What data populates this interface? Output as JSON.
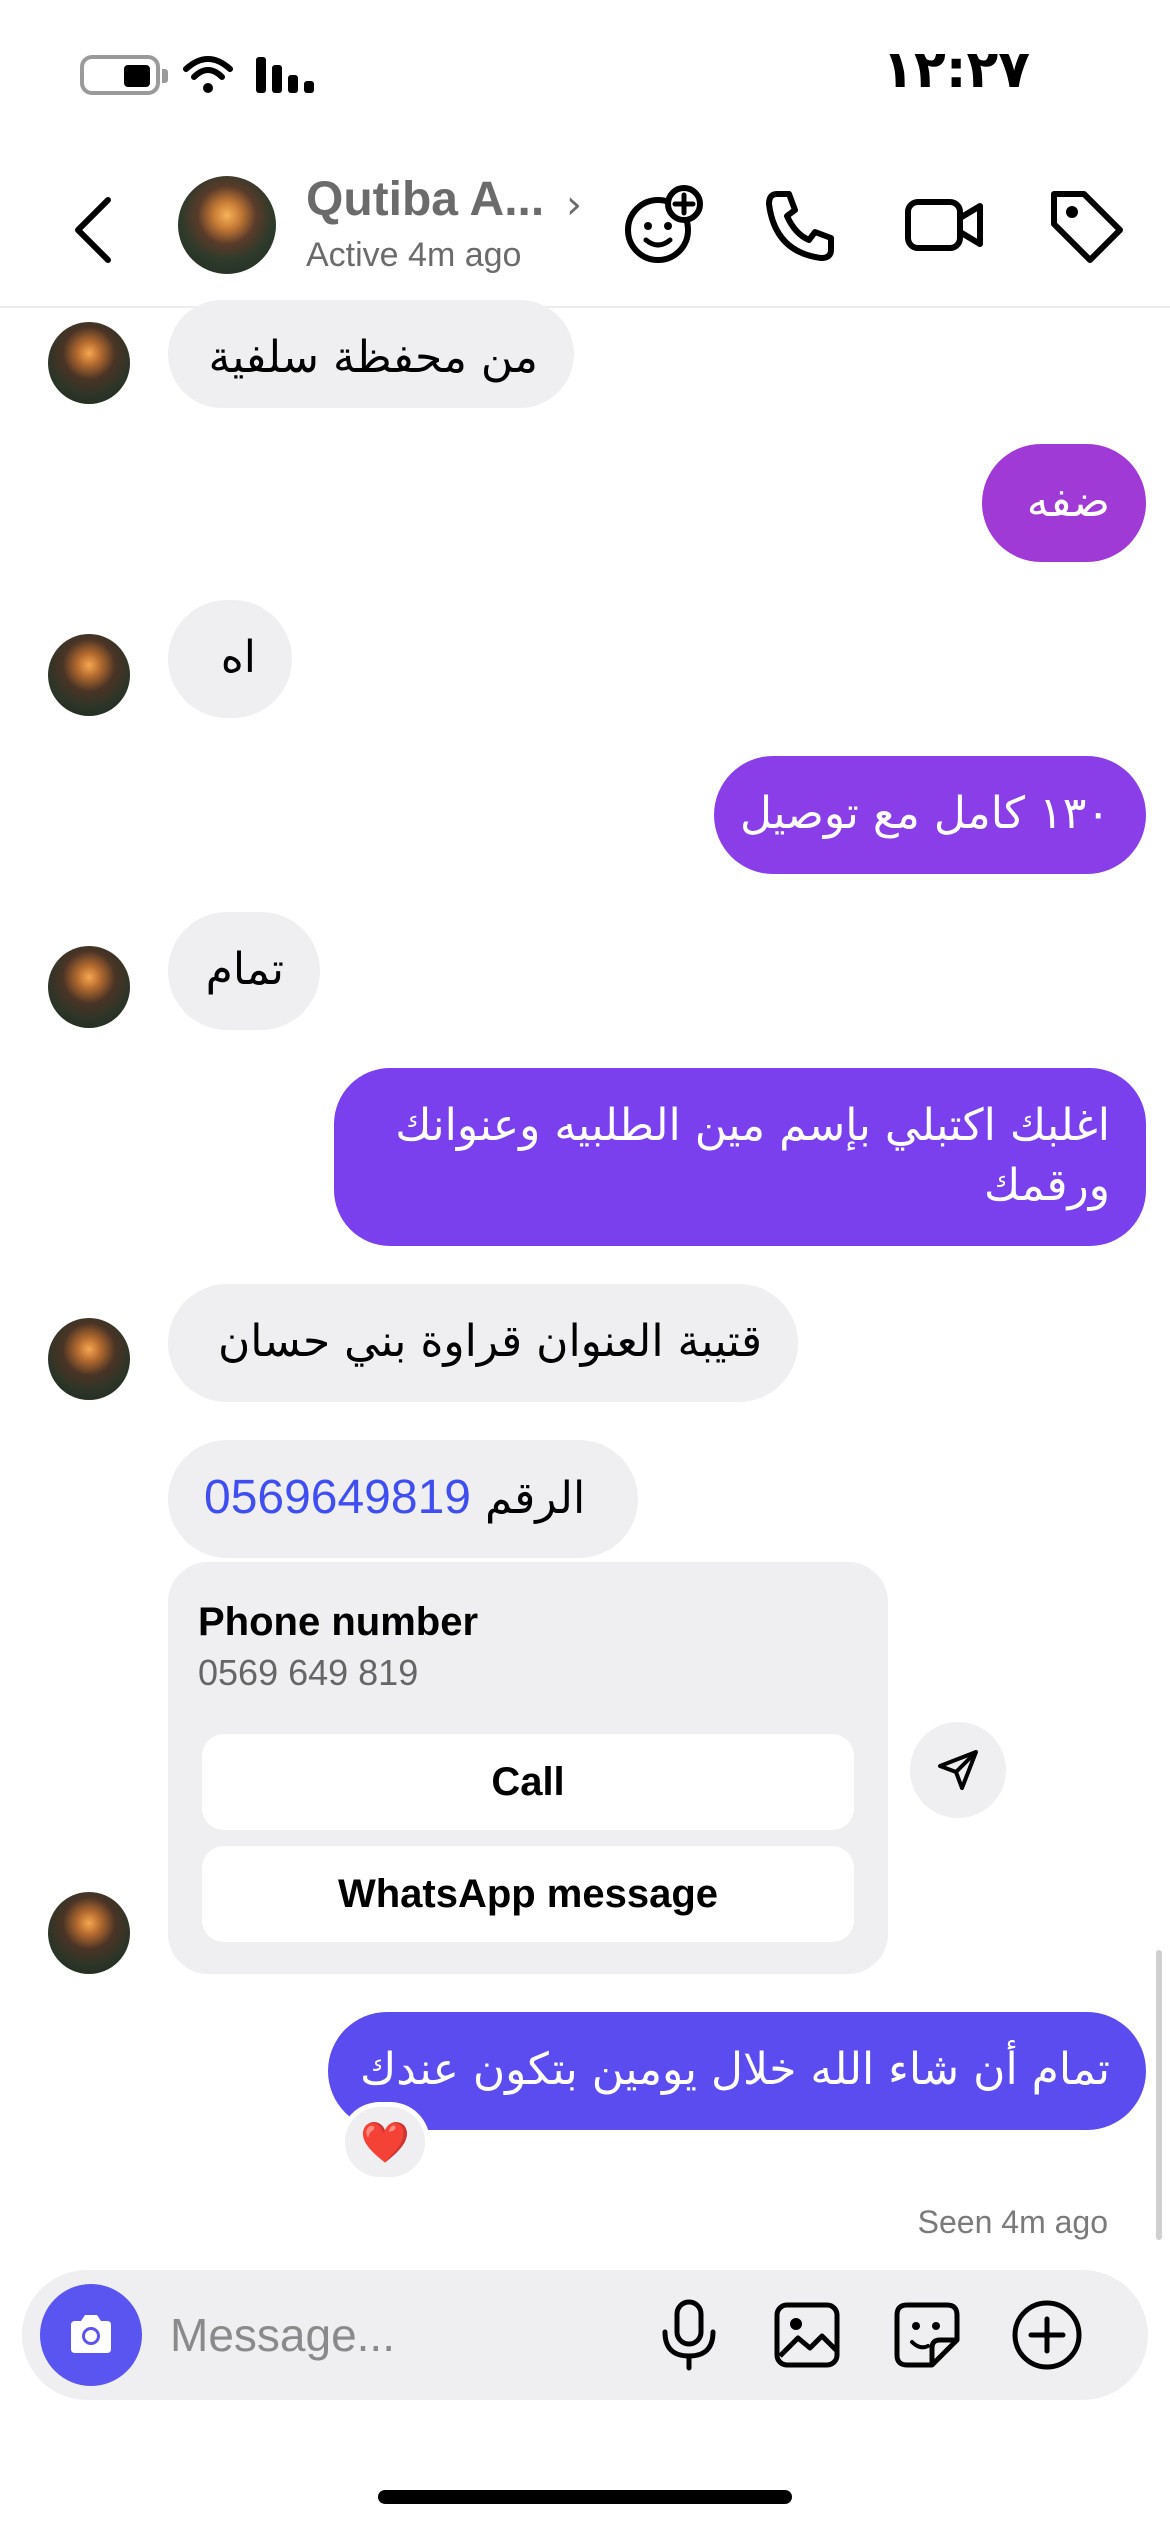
{
  "status_bar": {
    "time": "١٢:٢٧"
  },
  "header": {
    "contact_name": "Qutiba A...",
    "contact_status": "Active 4m ago",
    "icons": [
      "back-icon",
      "add-people-icon",
      "phone-icon",
      "video-icon",
      "tag-icon"
    ]
  },
  "messages": [
    {
      "side": "in",
      "text": "من محفظة سلفية"
    },
    {
      "side": "out",
      "text": "ضفه"
    },
    {
      "side": "in",
      "text": "اه"
    },
    {
      "side": "out",
      "text": "١٣٠ كامل مع توصيل"
    },
    {
      "side": "in",
      "text": "تمام"
    },
    {
      "side": "out",
      "line1": "اغلبك اكتبلي بإسم مين الطلبيه وعنوانك",
      "line2": "ورقمك"
    },
    {
      "side": "in",
      "text": "قتيبة   العنوان قراوة بني حسان"
    },
    {
      "side": "in",
      "prefix": "الرقم",
      "number": "0569649819"
    },
    {
      "side": "out",
      "text": "تمام أن شاء الله خلال يومين بتكون عندك",
      "reaction": "❤️"
    }
  ],
  "phone_card": {
    "title": "Phone number",
    "number": "0569 649 819",
    "call_label": "Call",
    "whatsapp_label": "WhatsApp message"
  },
  "seen_text": "Seen 4m ago",
  "composer": {
    "placeholder": "Message...",
    "icons": [
      "camera-icon",
      "microphone-icon",
      "gallery-icon",
      "sticker-icon",
      "plus-icon"
    ]
  },
  "colors": {
    "bubble_in": "#efeff1",
    "out_gradient": [
      "#a03ad6",
      "#8a3ee8",
      "#7a40ee",
      "#6a46ef",
      "#5b4cf0"
    ],
    "link": "#3f4ef0",
    "camera_button": "#5a54f0"
  }
}
